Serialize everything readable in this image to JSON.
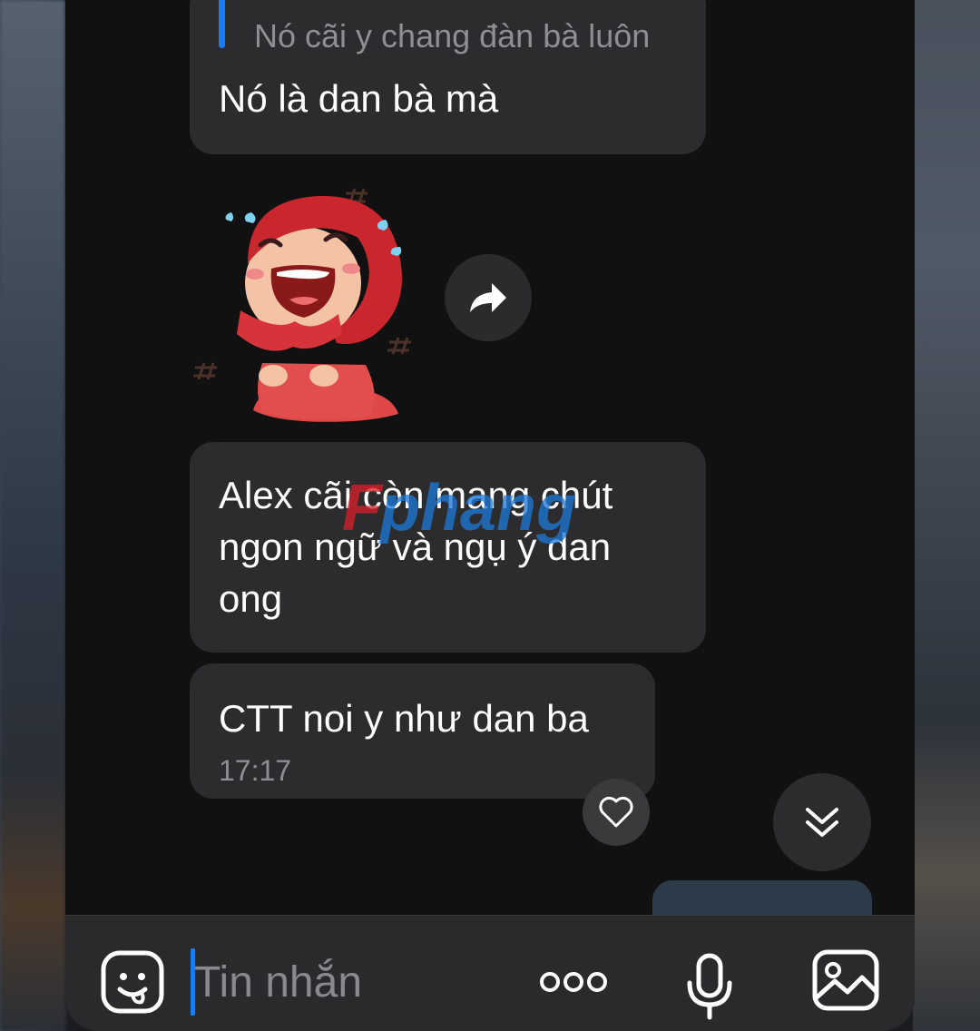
{
  "messages": [
    {
      "quote": {
        "text": "Nó cãi y chang đàn bà luôn"
      },
      "text": "Nó là dan bà mà"
    },
    {
      "sticker": "crying-laughing-red-hood-girl"
    },
    {
      "text": "Alex cãi còn mang chút ngon ngữ và ngụ ý dan ong"
    },
    {
      "text": "CTT noi y như dan ba",
      "time": "17:17"
    }
  ],
  "watermark": "Fphang",
  "input": {
    "placeholder": "Tin nhắn",
    "value": ""
  },
  "icons": {
    "forward": "forward-arrow-icon",
    "like": "heart-icon",
    "scroll_down": "double-chevron-down-icon",
    "sticker": "sticker-smiley-icon",
    "more": "more-dots-icon",
    "mic": "microphone-icon",
    "image": "image-icon"
  },
  "colors": {
    "accent": "#1a7cf5",
    "bubble": "#2c2c2e",
    "background": "#111111",
    "secondary_text": "#8e8e93"
  }
}
